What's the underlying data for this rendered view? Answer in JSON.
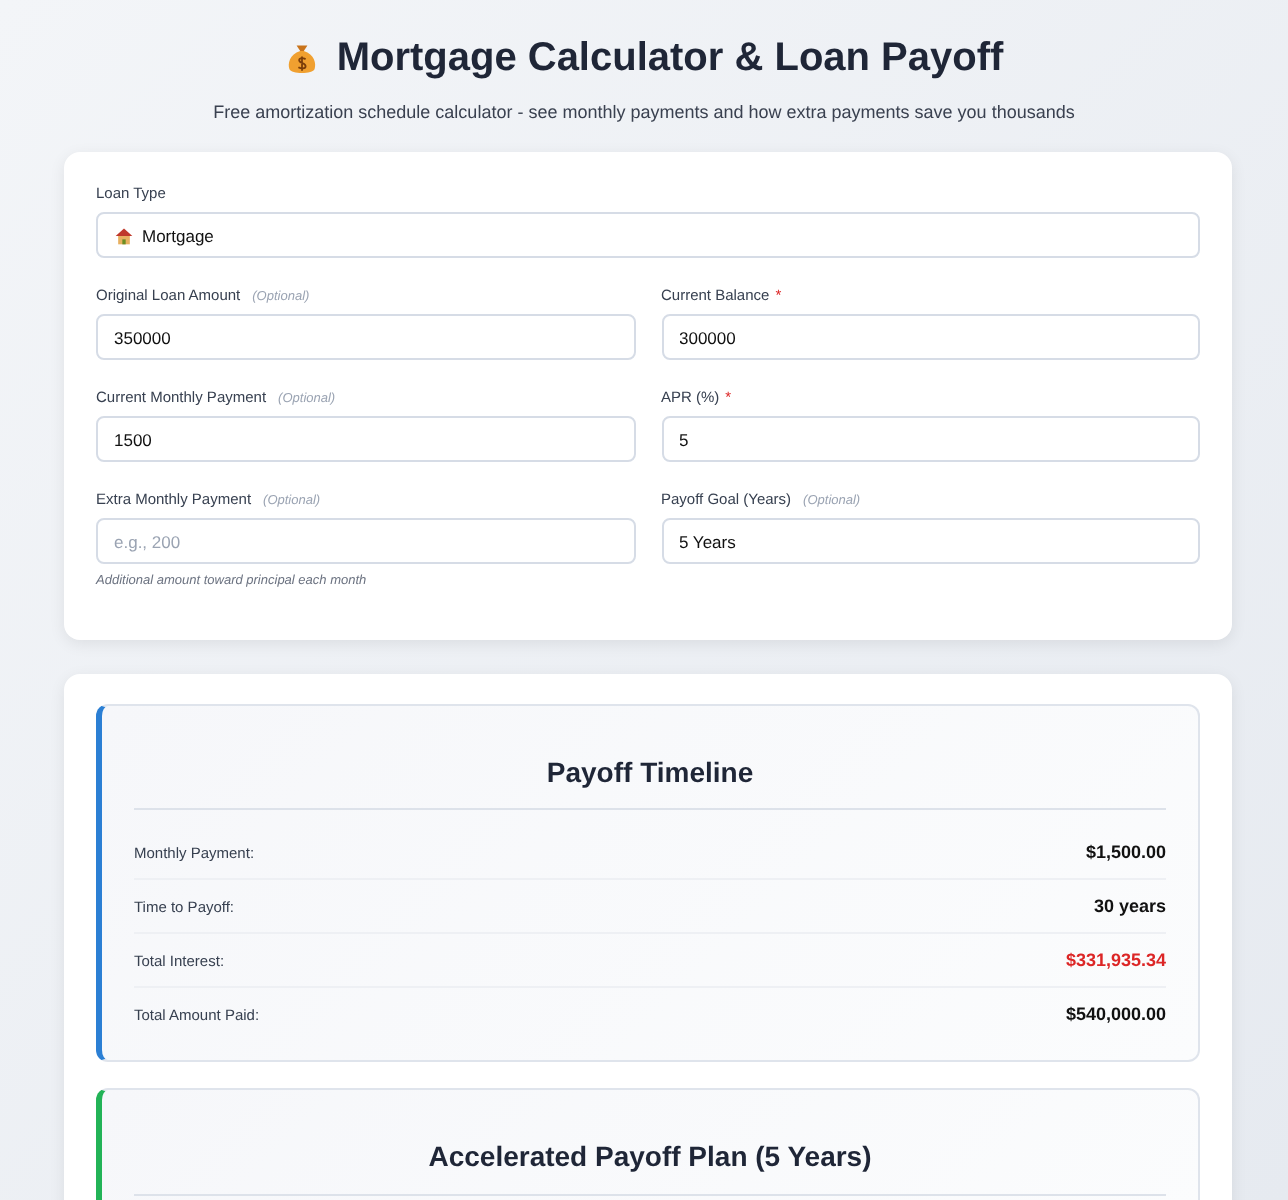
{
  "header": {
    "title": "Mortgage Calculator & Loan Payoff",
    "subtitle": "Free amortization schedule calculator - see monthly payments and how extra payments save you thousands"
  },
  "form": {
    "loan_type": {
      "label": "Loan Type",
      "value": "Mortgage"
    },
    "fields": [
      {
        "label": "Original Loan Amount",
        "note": "(Optional)",
        "value": "350000"
      },
      {
        "label": "Current Balance",
        "marker": "*",
        "value": "300000"
      },
      {
        "label": "Current Monthly Payment",
        "note": "(Optional)",
        "value": "1500"
      },
      {
        "label": "APR (%)",
        "marker": "*",
        "value": "5"
      },
      {
        "label": "Extra Monthly Payment",
        "note": "(Optional)",
        "placeholder": "e.g., 200",
        "hint": "Additional amount toward principal each month"
      },
      {
        "label": "Payoff Goal (Years)",
        "note": "(Optional)",
        "value": "5 Years"
      }
    ]
  },
  "results": [
    {
      "title": "Payoff Timeline",
      "color": "#2b7fd4",
      "rows": [
        {
          "label": "Monthly Payment:",
          "value": "$1,500.00",
          "negative": false
        },
        {
          "label": "Time to Payoff:",
          "value": "30 years",
          "negative": false
        },
        {
          "label": "Total Interest:",
          "value": "$331,935.34",
          "negative": true
        },
        {
          "label": "Total Amount Paid:",
          "value": "$540,000.00",
          "negative": false
        }
      ]
    },
    {
      "title": "Accelerated Payoff Plan (5 Years)",
      "color": "#22b357"
    }
  ]
}
